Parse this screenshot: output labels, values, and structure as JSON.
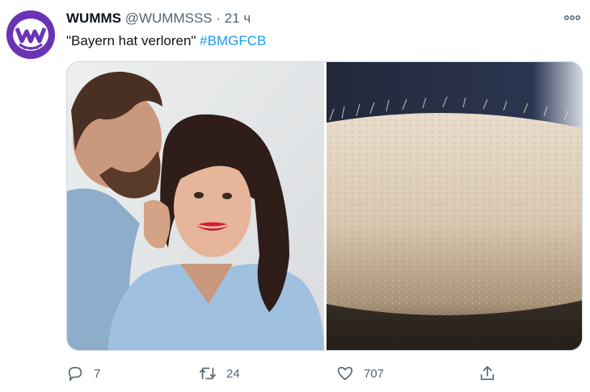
{
  "tweet": {
    "author": {
      "name": "WUMMS",
      "handle": "@WUMMSSS",
      "separator": "·",
      "time": "21 ч",
      "avatar_letter": "W",
      "avatar_color": "#6a33b5"
    },
    "text": {
      "quote": "\"Bayern hat verloren\"",
      "hashtag": "#BMGFCB"
    },
    "media": [
      {
        "icon": "couple-whispering-photo"
      },
      {
        "icon": "goosebumps-skin-photo"
      }
    ],
    "actions": {
      "reply": {
        "icon": "reply-icon",
        "count": "7"
      },
      "retweet": {
        "icon": "retweet-icon",
        "count": "24"
      },
      "like": {
        "icon": "heart-icon",
        "count": "707"
      },
      "share": {
        "icon": "share-icon"
      }
    }
  },
  "colors": {
    "link": "#1d9bf0",
    "secondary_text": "#536471",
    "primary_text": "#0f1419"
  }
}
